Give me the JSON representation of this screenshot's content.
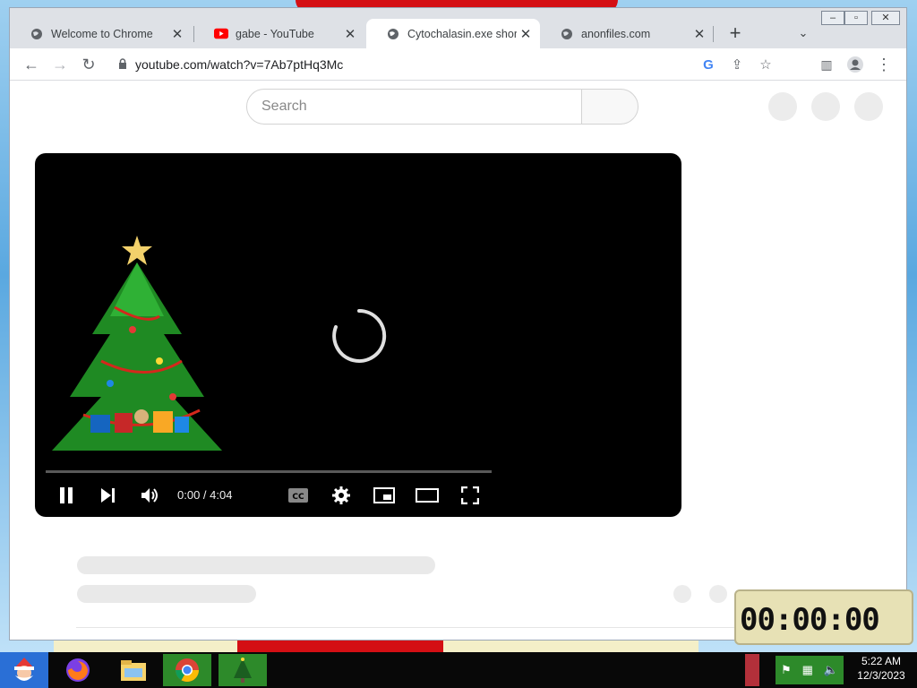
{
  "tabs": [
    {
      "title": "Welcome to Chrome",
      "icon": "globe-icon"
    },
    {
      "title": "gabe - YouTube",
      "icon": "youtube-icon"
    },
    {
      "title": "Cytochalasin.exe short h",
      "icon": "globe-icon"
    },
    {
      "title": "anonfiles.com",
      "icon": "globe-icon"
    }
  ],
  "address_bar": {
    "url": "youtube.com/watch?v=7Ab7ptHq3Mc"
  },
  "youtube": {
    "search_placeholder": "Search",
    "player": {
      "current_time": "0:00",
      "duration": "4:04",
      "time_display": "0:00 / 4:04",
      "progress_fraction": 0.0,
      "state": "loading"
    }
  },
  "stopwatch": {
    "display": "00:00:00"
  },
  "taskbar": {
    "apps": [
      "firefox-icon",
      "file-explorer-icon",
      "chrome-icon",
      "christmas-tree-icon"
    ],
    "clock": {
      "time": "5:22 AM",
      "date": "12/3/2023"
    }
  },
  "colors": {
    "youtube_red": "#ff0000",
    "tab_strip": "#dee1e6",
    "player_bg": "#000000",
    "taskbar": "#080808"
  }
}
